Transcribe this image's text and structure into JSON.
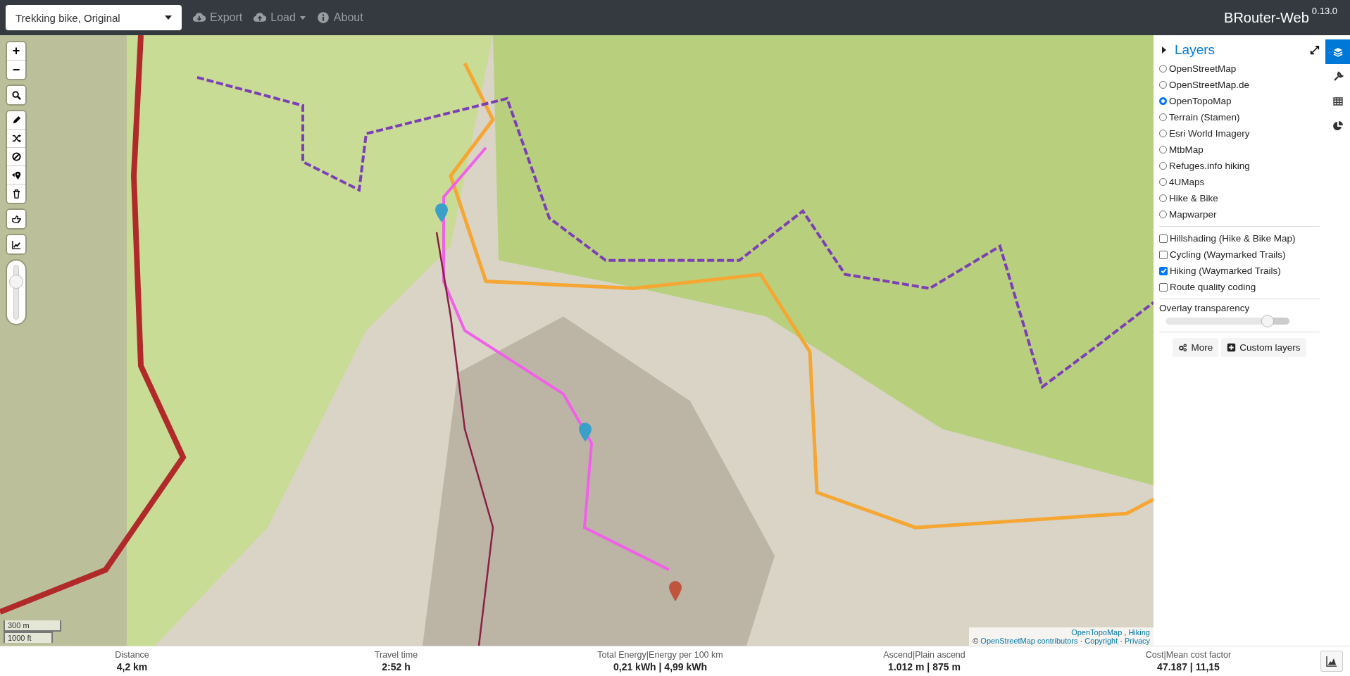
{
  "top_bar": {
    "profile_select": "Trekking bike, Original",
    "menu": [
      {
        "kind": "export",
        "label": "Export",
        "dropdown": false
      },
      {
        "kind": "load",
        "label": "Load",
        "dropdown": true
      },
      {
        "kind": "about",
        "label": "About",
        "dropdown": false
      }
    ],
    "app_title": "BRouter-Web",
    "version": "0.13.0"
  },
  "map": {
    "zoom_in": "+",
    "zoom_out": "−",
    "tools": [
      {
        "kind": "search"
      },
      {
        "kind": "draw"
      },
      {
        "kind": "reverse"
      },
      {
        "kind": "nogo"
      },
      {
        "kind": "delete-last"
      },
      {
        "kind": "delete-all"
      },
      {
        "kind": "poi"
      },
      {
        "kind": "elevation"
      }
    ],
    "zoom_slider": {
      "level": 0.7
    },
    "scale": [
      "300 m",
      "1000 ft"
    ],
    "attribution": [
      [
        {
          "kind": "link",
          "text": "OpenTopoMap"
        },
        {
          "kind": "text",
          "text": ","
        },
        {
          "kind": "link",
          "text": "Hiking"
        }
      ],
      [
        {
          "kind": "text",
          "text": "©"
        },
        {
          "kind": "link",
          "text": "OpenStreetMap contributors"
        },
        {
          "kind": "text",
          "text": "·"
        },
        {
          "kind": "link",
          "text": "Copyright"
        },
        {
          "kind": "text",
          "text": "·"
        },
        {
          "kind": "link",
          "text": "Privacy"
        }
      ]
    ]
  },
  "layers_panel": {
    "title": "Layers",
    "expanded": false,
    "base_layers": [
      {
        "label": "OpenStreetMap",
        "selected": false
      },
      {
        "label": "OpenStreetMap.de",
        "selected": false
      },
      {
        "label": "OpenTopoMap",
        "selected": true
      },
      {
        "label": "Terrain (Stamen)",
        "selected": false
      },
      {
        "label": "Esri World Imagery",
        "selected": false
      },
      {
        "label": "MtbMap",
        "selected": false
      },
      {
        "label": "Refuges.info hiking",
        "selected": false
      },
      {
        "label": "4UMaps",
        "selected": false
      },
      {
        "label": "Hike & Bike",
        "selected": false
      },
      {
        "label": "Mapwarper",
        "selected": false
      }
    ],
    "overlays": [
      {
        "label": "Hillshading (Hike & Bike Map)",
        "checked": false
      },
      {
        "label": "Cycling (Waymarked Trails)",
        "checked": false
      },
      {
        "label": "Hiking (Waymarked Trails)",
        "checked": true
      },
      {
        "label": "Route quality coding",
        "checked": false
      }
    ],
    "overlay_transparency": {
      "label": "Overlay transparency",
      "level": 0.82
    },
    "buttons": [
      {
        "kind": "more",
        "label": "More"
      },
      {
        "kind": "custom",
        "label": "Custom layers"
      }
    ]
  },
  "sidebar_tabs": [
    {
      "kind": "layers",
      "selected": true
    },
    {
      "kind": "profile",
      "selected": false
    },
    {
      "kind": "table",
      "selected": false
    },
    {
      "kind": "analysis",
      "selected": false
    }
  ],
  "stats": [
    {
      "label": "Distance",
      "value": "4,2 km"
    },
    {
      "label": "Travel time",
      "value": "2:52 h"
    },
    {
      "label": "Total Energy|Energy per 100 km",
      "value": "0,21 kWh | 4,99 kWh"
    },
    {
      "label": "Ascend|Plain ascend",
      "value": "1.012 m | 875 m"
    },
    {
      "label": "Cost|Mean cost factor",
      "value": "47.187 | 11,15"
    }
  ]
}
